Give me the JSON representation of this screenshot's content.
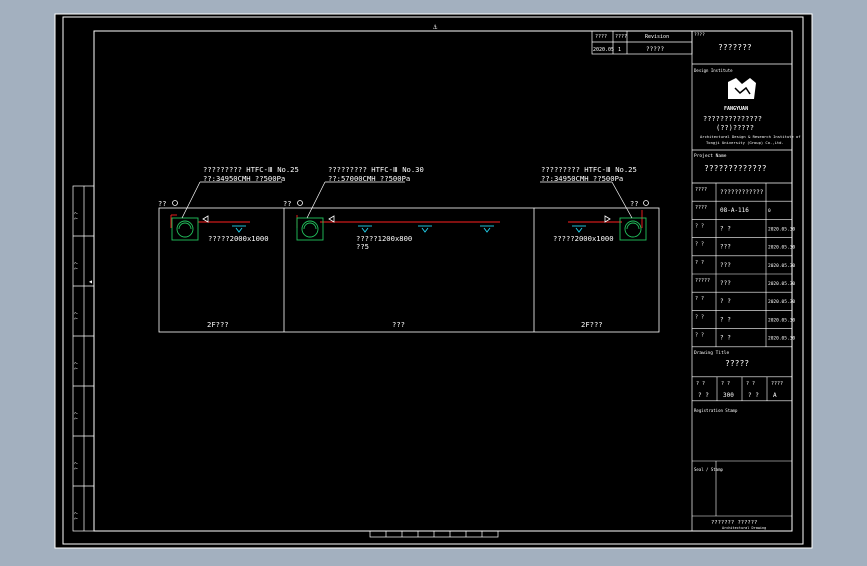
{
  "colors": {
    "background": "#a3b0bf",
    "canvas": "#000000",
    "line": "#ffffff",
    "duct": "#ff2020",
    "fan": "#22c55e",
    "diffuser": "#22d3ee"
  },
  "diagram": {
    "fan_left_label_line1": "????????? HTFC-Ⅲ No.25",
    "fan_left_label_line2": "??:34950CMH ??500Pa",
    "fan_mid_label_line1": "????????? HTFC-Ⅲ No.30",
    "fan_mid_label_line2": "??:57000CMH ??500Pa",
    "fan_right_label_line1": "????????? HTFC-Ⅲ No.25",
    "fan_right_label_line2": "??:34950CMH ??500Pa",
    "outlet_left": "??",
    "outlet_mid": "??",
    "outlet_right": "??",
    "duct_left": "?????2000x1000",
    "duct_mid": "?????1200x800",
    "duct_mid_sub": "??5",
    "duct_right": "?????2000x1000",
    "room_left": "2F???",
    "room_mid": "???",
    "room_right": "2F???"
  },
  "title_block": {
    "top_row1_col1": "????",
    "top_row1_col2": "????",
    "top_row1_col3": "Revision",
    "top_row2_col1": "2020.05",
    "top_row2_col2": "1",
    "top_row2_col3": "?????",
    "owner_label": "????",
    "owner_value": "???????",
    "institute_label": "Design Institute",
    "logo_text": "FANGYUAN",
    "institute_name_line1": "??????????????",
    "institute_name_line2": "(??)?????",
    "institute_en_line1": "Architectural Design & Research Institute of",
    "institute_en_line2": "Tongji University (Group) Co.,Ltd.",
    "project_label": "Project Name",
    "project_value": "?????????????",
    "rows": [
      {
        "label": "????",
        "value": "????????????",
        "date": ""
      },
      {
        "label": "????",
        "value": "08-A-116",
        "date": "0"
      },
      {
        "label": "? ?",
        "value": "? ?",
        "date": "2020.05.30"
      },
      {
        "label": "? ?",
        "value": "???",
        "date": "2020.05.30"
      },
      {
        "label": "? ?",
        "value": "???",
        "date": "2020.05.30"
      },
      {
        "label": "?????",
        "value": "???",
        "date": "2020.05.30"
      },
      {
        "label": "? ?",
        "value": "? ?",
        "date": "2020.05.30"
      },
      {
        "label": "? ?",
        "value": "? ?",
        "date": "2020.05.30"
      },
      {
        "label": "? ?",
        "value": "? ?",
        "date": "2020.05.30"
      }
    ],
    "drawing_label": "Drawing Title",
    "drawing_value": "?????",
    "scale_row_labels": [
      "? ?",
      "? ?",
      "? ?",
      "????"
    ],
    "scale_row_values": [
      "? ?",
      "300",
      "? ?",
      "A"
    ],
    "stamp_label": "Registration Stamp",
    "seal_label": "Seal / Stamp",
    "bottom_note": "??????? ??????",
    "bottom_note_en": "Architectural Drawing"
  },
  "left_strip": {
    "labels": [
      "? ?",
      "? ?",
      "? ?",
      "? ?",
      "? ?",
      "? ?",
      "? ?"
    ]
  }
}
